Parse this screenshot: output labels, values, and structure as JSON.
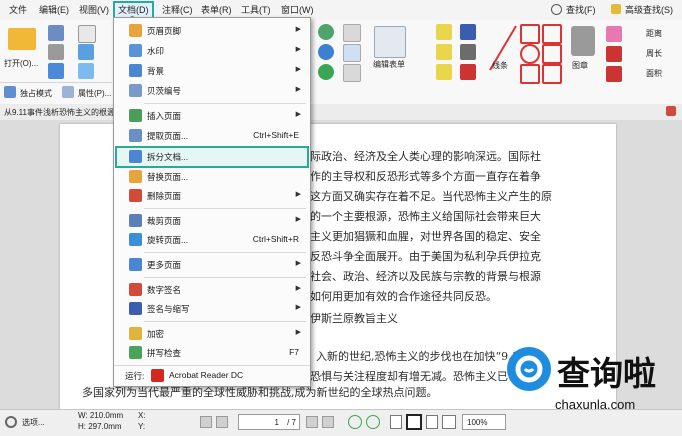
{
  "menubar": {
    "items": [
      "文件",
      "编辑(E)",
      "视图(V)",
      "文档(D)",
      "注释(C)",
      "表单(R)",
      "工具(T)",
      "窗口(W)"
    ],
    "right_search": "查找(F)",
    "right_adv_search": "高级查找(S)"
  },
  "ribbon": {
    "open_label": "打开(O)...",
    "exclusive_mode": "独占模式",
    "properties": "属性(P)...",
    "edit_form": "编辑表单",
    "lines": "线条",
    "shapes": "图章",
    "distance": "距离",
    "perimeter": "周长",
    "area": "面积"
  },
  "tab": {
    "title": "从9.11事件浅析恐怖主义的根源..."
  },
  "menu": {
    "items": [
      {
        "label": "页眉页脚",
        "shortcut": "",
        "submenu": true
      },
      {
        "label": "水印",
        "shortcut": "",
        "submenu": true
      },
      {
        "label": "背景",
        "shortcut": "",
        "submenu": true
      },
      {
        "label": "贝茨编号",
        "shortcut": "",
        "submenu": true
      },
      {
        "label": "插入页面",
        "shortcut": "",
        "submenu": true
      },
      {
        "label": "提取页面...",
        "shortcut": "Ctrl+Shift+E",
        "submenu": false
      },
      {
        "label": "拆分文档...",
        "shortcut": "",
        "submenu": false
      },
      {
        "label": "替换页面...",
        "shortcut": "",
        "submenu": false
      },
      {
        "label": "删除页面",
        "shortcut": "",
        "submenu": true
      },
      {
        "label": "裁剪页面",
        "shortcut": "",
        "submenu": true
      },
      {
        "label": "旋转页面...",
        "shortcut": "Ctrl+Shift+R",
        "submenu": false
      },
      {
        "label": "更多页面",
        "shortcut": "",
        "submenu": true
      },
      {
        "label": "数字签名",
        "shortcut": "",
        "submenu": true
      },
      {
        "label": "签名与缩写",
        "shortcut": "",
        "submenu": true
      },
      {
        "label": "加密",
        "shortcut": "",
        "submenu": true
      },
      {
        "label": "拼写检查",
        "shortcut": "F7",
        "submenu": false
      }
    ],
    "run_label": "运行:",
    "run_app": "Acrobat Reader DC"
  },
  "document": {
    "lines": [
      "际政治、经济及全人类心理的影响深远。国际社",
      "作的主导权和反恐形式等多个方面一直存在着争",
      "这方面又确实存在着不足。当代恐怖主义产生的原",
      "的一个主要根源，恐怖主义给国际社会带来巨大",
      "主义更加猖獗和血腥，对世界各国的稳定、安全",
      "反恐斗争全面展开。由于美国为私利孕兵伊拉克",
      "社会、政治、经济以及民族与宗教的背景与根源",
      "如何用更加有效的合作途径共同反恐。",
      "伊斯兰原教旨主义",
      "入新的世纪,恐怖主义的步伐也在加快“9.11",
      "恐惧与关注程度却有增无减。恐怖主义已",
      "多国家列为当代最严重的全球性威胁和挑战,成为新世纪的全球热点问题。"
    ]
  },
  "status": {
    "options": "选项...",
    "width": "W: 210.0mm",
    "height": "H: 297.0mm",
    "x": "X:",
    "y": "Y:",
    "page": "1",
    "page_total": "/ 7",
    "zoom": "100%"
  },
  "watermark": {
    "brand": "查询啦",
    "domain": "chaxunla.com"
  },
  "colors": {
    "highlight": "#2aa89a",
    "menu_bg": "#fbfbfb",
    "watermark_blue": "#1e8de0"
  }
}
